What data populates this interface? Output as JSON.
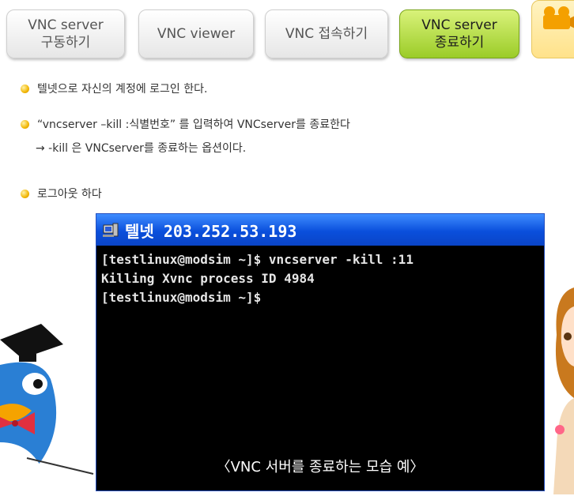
{
  "tabs": [
    {
      "label": "VNC server\n구동하기",
      "active": false
    },
    {
      "label": "VNC viewer",
      "active": false
    },
    {
      "label": "VNC 접속하기",
      "active": false
    },
    {
      "label": "VNC server\n종료하기",
      "active": true
    }
  ],
  "bullets": {
    "b1": "텔넷으로 자신의 계정에 로그인 한다.",
    "b2": "“vncserver –kill :식별번호” 를 입력하여 VNCserver를 종료한다",
    "b2_sub": "→ -kill 은 VNCserver를 종료하는 옵션이다.",
    "b3": "로그아웃 하다"
  },
  "telnet": {
    "title": "텔넷 203.252.53.193",
    "lines": [
      "[testlinux@modsim ~]$ vncserver -kill :11",
      "Killing Xvnc process ID 4984",
      "[testlinux@modsim ~]$"
    ],
    "caption": "〈VNC 서버를 종료하는 모습 예〉"
  },
  "icons": {
    "bullet": "bullet-dot-icon",
    "camera": "video-camera-icon",
    "telnet_window": "telnet-app-icon"
  },
  "colors": {
    "active_tab": "#9bcc28",
    "titlebar": "#0a4fdc",
    "bullet": "#f2b705"
  }
}
